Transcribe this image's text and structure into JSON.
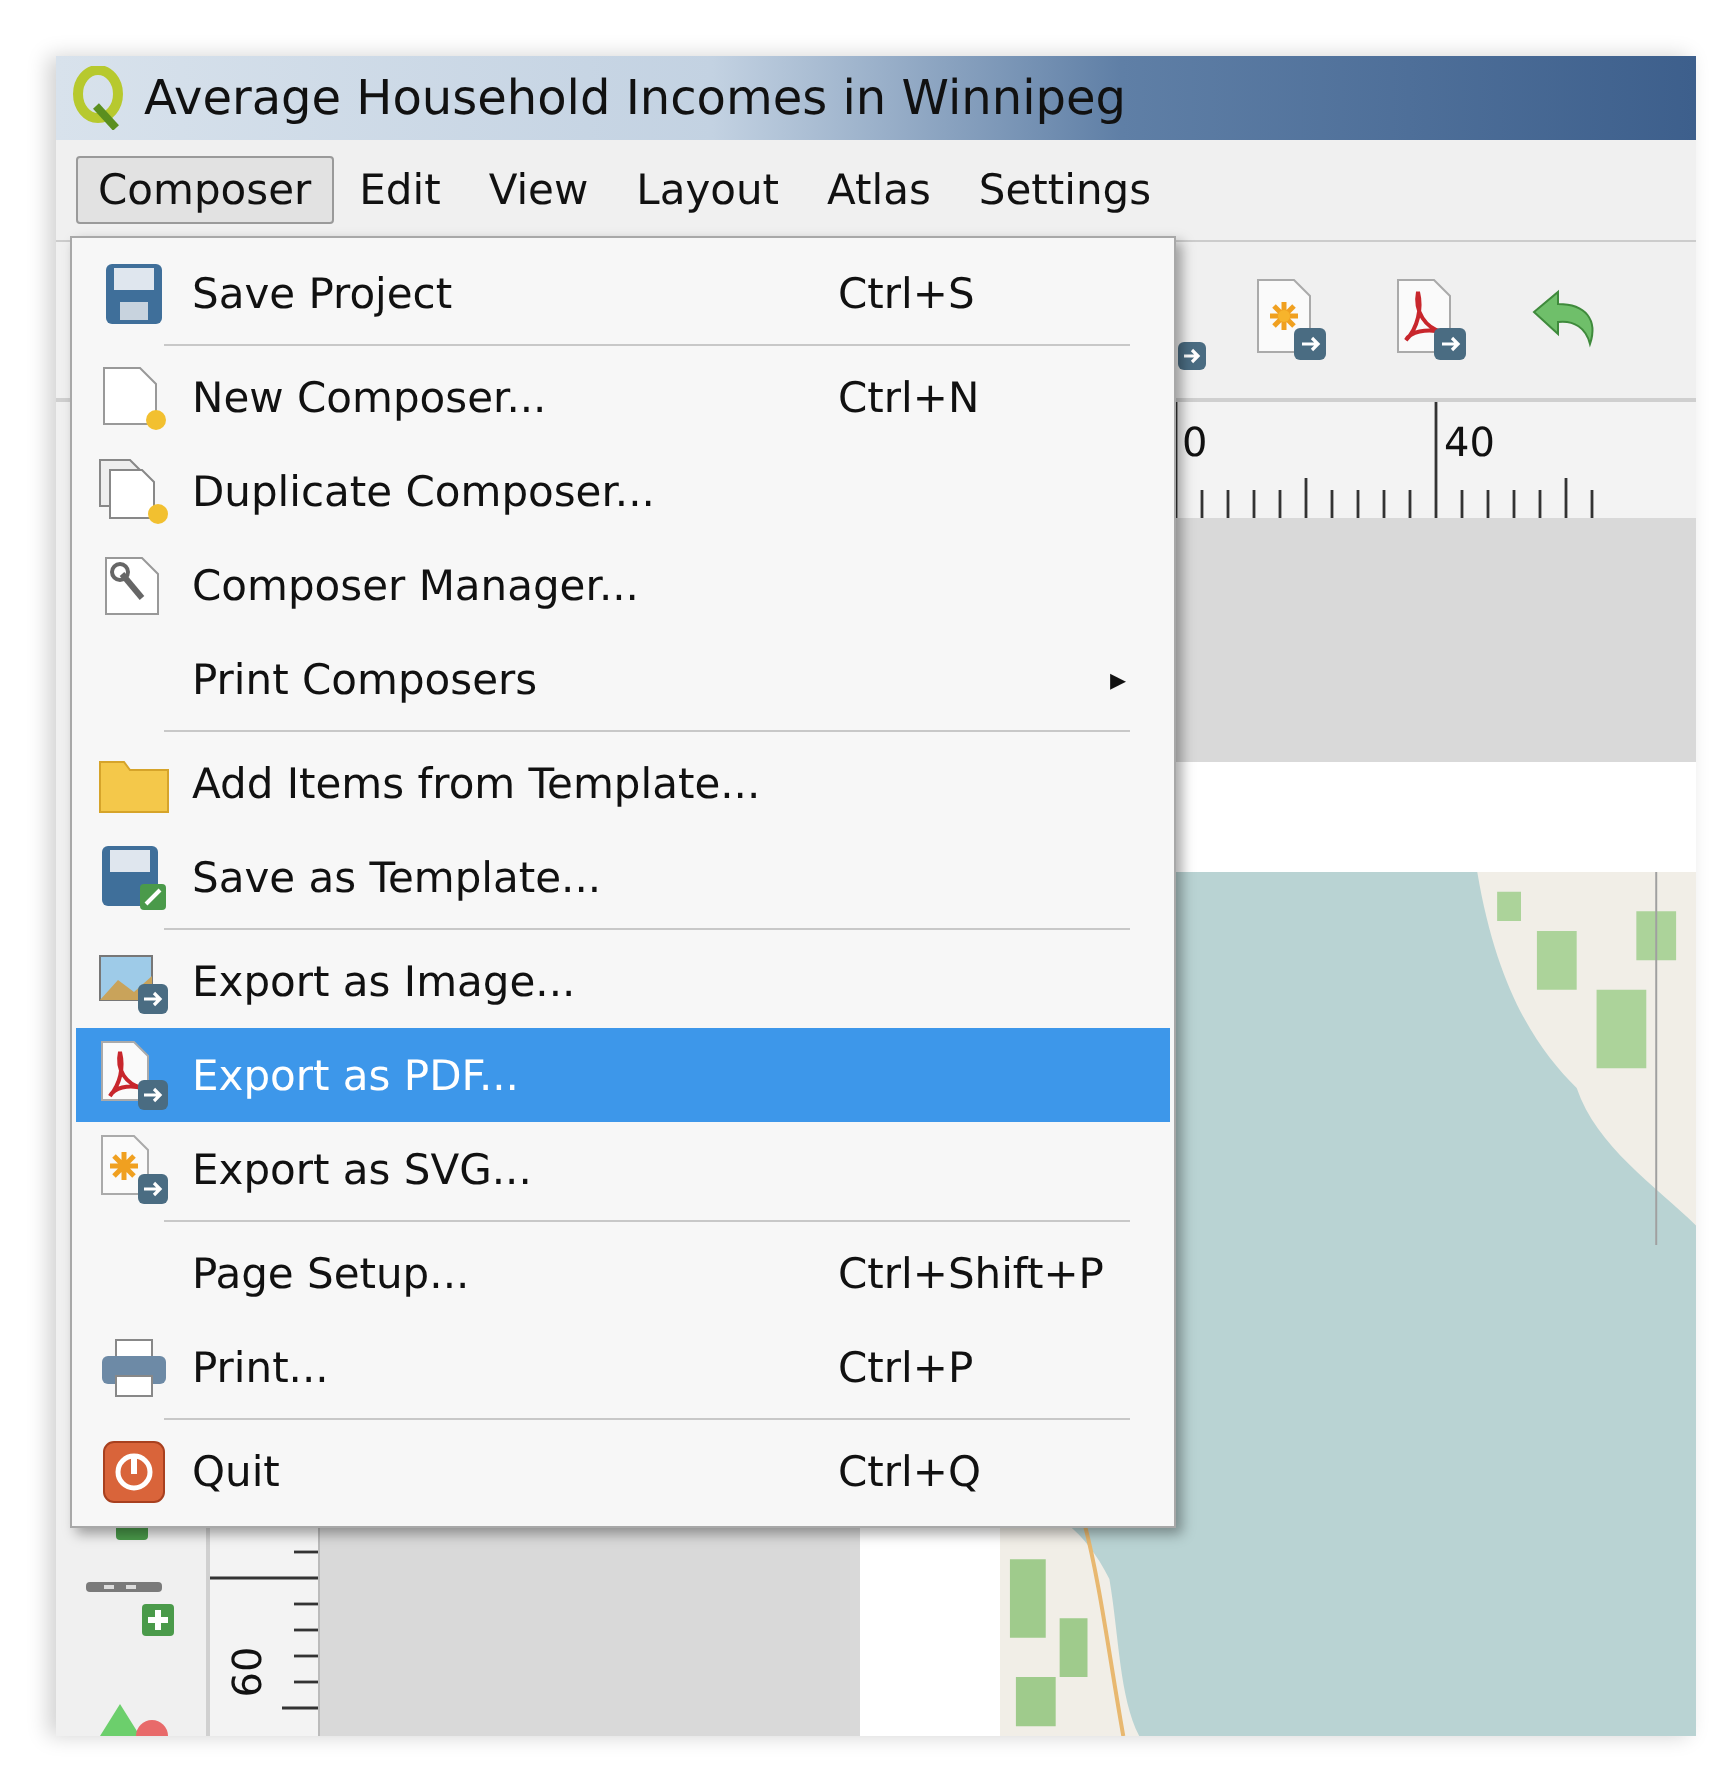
{
  "window": {
    "title": "Average Household Incomes in Winnipeg"
  },
  "menu_bar": [
    {
      "label": "Composer",
      "selected": true
    },
    {
      "label": "Edit",
      "selected": false
    },
    {
      "label": "View",
      "selected": false
    },
    {
      "label": "Layout",
      "selected": false
    },
    {
      "label": "Atlas",
      "selected": false
    },
    {
      "label": "Settings",
      "selected": false
    }
  ],
  "menu": [
    {
      "kind": "item",
      "label": "Save Project",
      "shortcut": "Ctrl+S",
      "selected": false
    },
    {
      "kind": "separator"
    },
    {
      "kind": "item",
      "label": "New Composer...",
      "shortcut": "Ctrl+N",
      "selected": false
    },
    {
      "kind": "item",
      "label": "Duplicate Composer...",
      "selected": false
    },
    {
      "kind": "item",
      "label": "Composer Manager...",
      "selected": false
    },
    {
      "kind": "submenu",
      "label": "Print Composers",
      "submenu_arrow": "▸",
      "selected": false
    },
    {
      "kind": "separator"
    },
    {
      "kind": "item",
      "label": "Add Items from Template...",
      "selected": false
    },
    {
      "kind": "item",
      "label": "Save as Template...",
      "selected": false
    },
    {
      "kind": "separator"
    },
    {
      "kind": "item",
      "label": "Export as Image...",
      "selected": false
    },
    {
      "kind": "item",
      "label": "Export as PDF...",
      "selected": true
    },
    {
      "kind": "item",
      "label": "Export as SVG...",
      "selected": false
    },
    {
      "kind": "separator"
    },
    {
      "kind": "item",
      "label": "Page Setup...",
      "shortcut": "Ctrl+Shift+P",
      "selected": false
    },
    {
      "kind": "item",
      "label": "Print...",
      "shortcut": "Ctrl+P",
      "selected": false
    },
    {
      "kind": "separator"
    },
    {
      "kind": "item",
      "label": "Quit",
      "shortcut": "Ctrl+Q",
      "selected": false
    }
  ],
  "ruler_top": {
    "labels": [
      "0",
      "40"
    ]
  },
  "ruler_left": {
    "labels": [
      "60"
    ]
  }
}
